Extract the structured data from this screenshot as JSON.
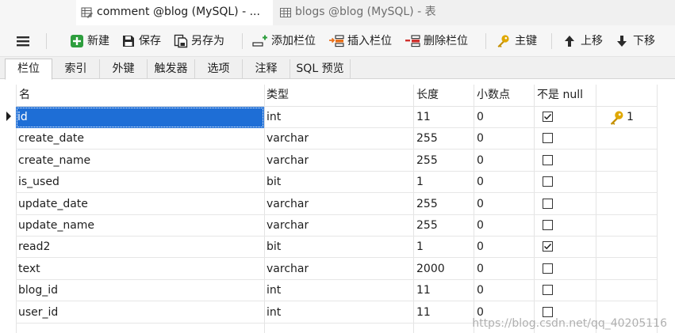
{
  "doc_tabs": [
    {
      "label": "comment @blog (MySQL) - ...",
      "icon": "table-design-icon",
      "active": true
    },
    {
      "label": "blogs @blog (MySQL) - 表",
      "icon": "table-grid-icon",
      "active": false
    }
  ],
  "toolbar": {
    "menu_icon": "hamburger-menu-icon",
    "new_label": "新建",
    "save_label": "保存",
    "save_as_label": "另存为",
    "add_field_label": "添加栏位",
    "insert_field_label": "插入栏位",
    "delete_field_label": "删除栏位",
    "primary_key_label": "主键",
    "move_up_label": "上移",
    "move_down_label": "下移"
  },
  "subtabs": [
    "栏位",
    "索引",
    "外键",
    "触发器",
    "选项",
    "注释",
    "SQL 预览"
  ],
  "columns": {
    "name": "名",
    "type": "类型",
    "length": "长度",
    "decimals": "小数点",
    "not_null": "不是 null"
  },
  "rows": [
    {
      "name": "id",
      "type": "int",
      "length": "11",
      "decimals": "0",
      "not_null": true,
      "key": "1"
    },
    {
      "name": "create_date",
      "type": "varchar",
      "length": "255",
      "decimals": "0",
      "not_null": false,
      "key": ""
    },
    {
      "name": "create_name",
      "type": "varchar",
      "length": "255",
      "decimals": "0",
      "not_null": false,
      "key": ""
    },
    {
      "name": "is_used",
      "type": "bit",
      "length": "1",
      "decimals": "0",
      "not_null": false,
      "key": ""
    },
    {
      "name": "update_date",
      "type": "varchar",
      "length": "255",
      "decimals": "0",
      "not_null": false,
      "key": ""
    },
    {
      "name": "update_name",
      "type": "varchar",
      "length": "255",
      "decimals": "0",
      "not_null": false,
      "key": ""
    },
    {
      "name": "read2",
      "type": "bit",
      "length": "1",
      "decimals": "0",
      "not_null": true,
      "key": ""
    },
    {
      "name": "text",
      "type": "varchar",
      "length": "2000",
      "decimals": "0",
      "not_null": false,
      "key": ""
    },
    {
      "name": "blog_id",
      "type": "int",
      "length": "11",
      "decimals": "0",
      "not_null": false,
      "key": ""
    },
    {
      "name": "user_id",
      "type": "int",
      "length": "11",
      "decimals": "0",
      "not_null": false,
      "key": ""
    }
  ],
  "watermark": "https://blog.csdn.net/qq_40205116",
  "colors": {
    "selection": "#1e6ed6",
    "key_gold": "#e0a800",
    "add_green": "#2e9e3e",
    "insert_orange": "#e8701a",
    "delete_red": "#d0312d"
  }
}
